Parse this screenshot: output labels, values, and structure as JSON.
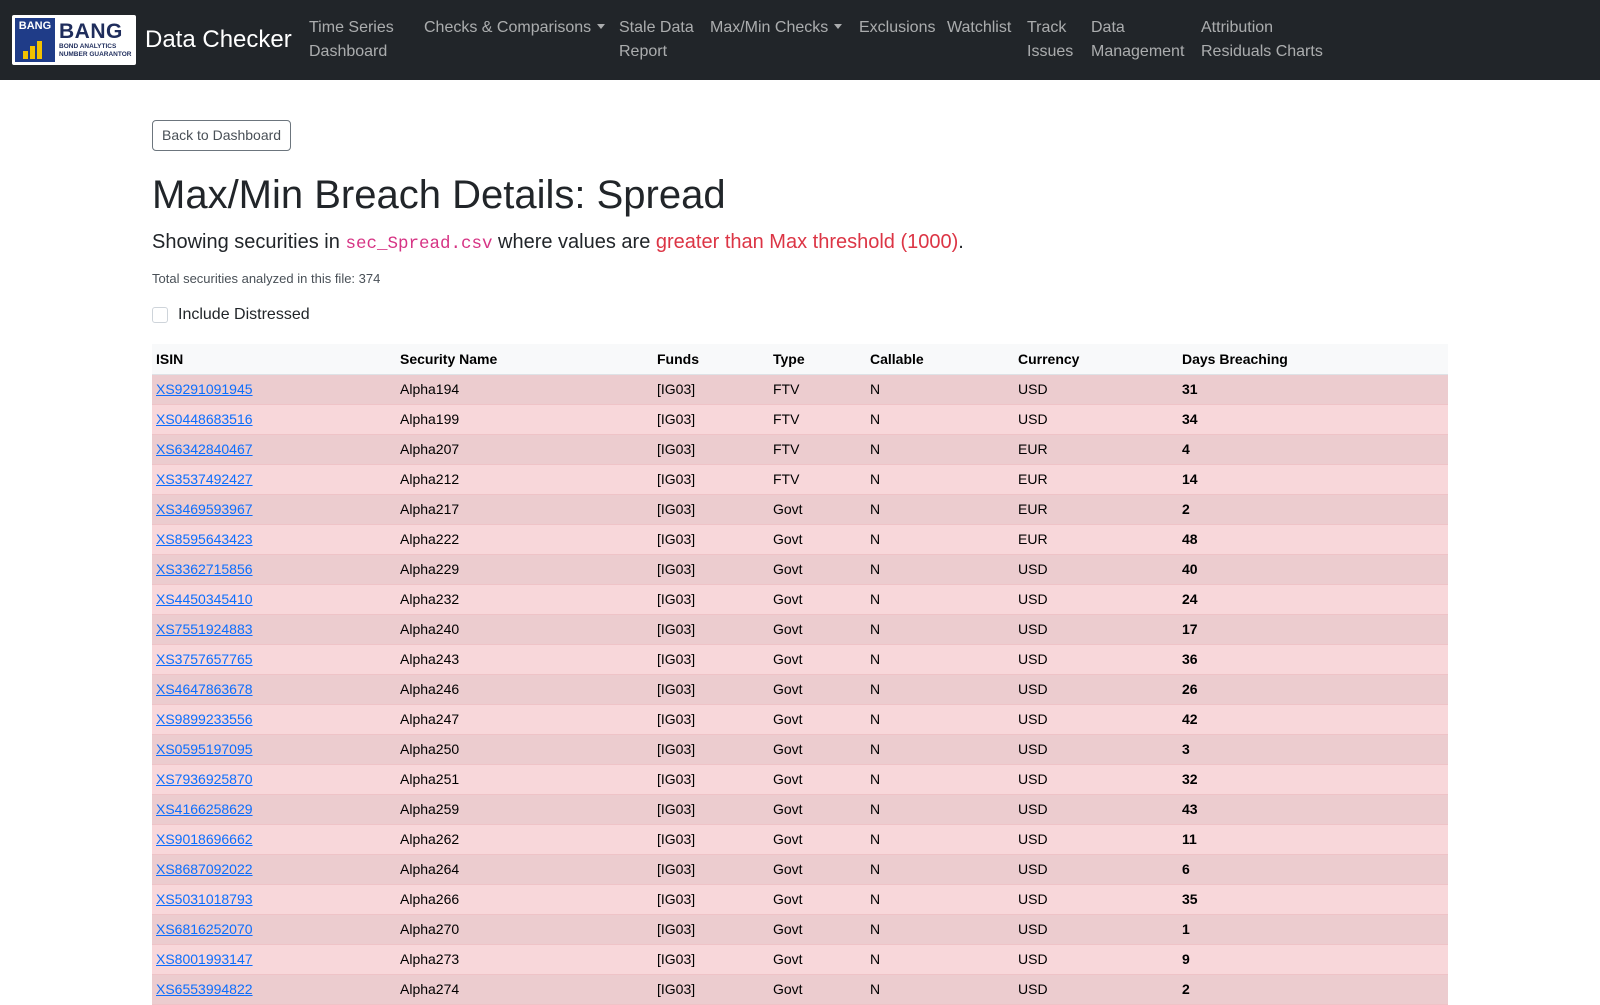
{
  "brand": {
    "logo_short": "BANG",
    "logo_big": "BANG",
    "logo_sub1": "BOND ANALYTICS",
    "logo_sub2": "NUMBER GUARANTOR",
    "title": "Data Checker"
  },
  "nav": [
    {
      "label": "Time Series Dashboard",
      "line1": "Time Series",
      "line2": "Dashboard",
      "dropdown": false
    },
    {
      "label": "Checks & Comparisons",
      "line1": "Checks & Comparisons",
      "line2": "",
      "dropdown": true
    },
    {
      "label": "Stale Data Report",
      "line1": "Stale Data",
      "line2": "Report",
      "dropdown": false
    },
    {
      "label": "Max/Min Checks",
      "line1": "Max/Min Checks",
      "line2": "",
      "dropdown": true
    },
    {
      "label": "Exclusions",
      "line1": "Exclusions",
      "line2": "",
      "dropdown": false
    },
    {
      "label": "Watchlist",
      "line1": "Watchlist",
      "line2": "",
      "dropdown": false
    },
    {
      "label": "Track Issues",
      "line1": "Track",
      "line2": "Issues",
      "dropdown": false
    },
    {
      "label": "Data Management",
      "line1": "Data",
      "line2": "Management",
      "dropdown": false
    },
    {
      "label": "Attribution Residuals Charts",
      "line1": "Attribution",
      "line2": "Residuals Charts",
      "dropdown": false
    }
  ],
  "main": {
    "back_button": "Back to Dashboard",
    "title": "Max/Min Breach Details: Spread",
    "lead_prefix": "Showing securities in ",
    "filename": "sec_Spread.csv",
    "lead_middle": " where values are ",
    "threshold_text": "greater than Max threshold (1000)",
    "lead_suffix": ".",
    "total_text": "Total securities analyzed in this file: 374",
    "checkbox_label": "Include Distressed"
  },
  "table": {
    "headers": [
      "ISIN",
      "Security Name",
      "Funds",
      "Type",
      "Callable",
      "Currency",
      "Days Breaching"
    ],
    "rows": [
      [
        "XS9291091945",
        "Alpha194",
        "[IG03]",
        "FTV",
        "N",
        "USD",
        "31"
      ],
      [
        "XS0448683516",
        "Alpha199",
        "[IG03]",
        "FTV",
        "N",
        "USD",
        "34"
      ],
      [
        "XS6342840467",
        "Alpha207",
        "[IG03]",
        "FTV",
        "N",
        "EUR",
        "4"
      ],
      [
        "XS3537492427",
        "Alpha212",
        "[IG03]",
        "FTV",
        "N",
        "EUR",
        "14"
      ],
      [
        "XS3469593967",
        "Alpha217",
        "[IG03]",
        "Govt",
        "N",
        "EUR",
        "2"
      ],
      [
        "XS8595643423",
        "Alpha222",
        "[IG03]",
        "Govt",
        "N",
        "EUR",
        "48"
      ],
      [
        "XS3362715856",
        "Alpha229",
        "[IG03]",
        "Govt",
        "N",
        "USD",
        "40"
      ],
      [
        "XS4450345410",
        "Alpha232",
        "[IG03]",
        "Govt",
        "N",
        "USD",
        "24"
      ],
      [
        "XS7551924883",
        "Alpha240",
        "[IG03]",
        "Govt",
        "N",
        "USD",
        "17"
      ],
      [
        "XS3757657765",
        "Alpha243",
        "[IG03]",
        "Govt",
        "N",
        "USD",
        "36"
      ],
      [
        "XS4647863678",
        "Alpha246",
        "[IG03]",
        "Govt",
        "N",
        "USD",
        "26"
      ],
      [
        "XS9899233556",
        "Alpha247",
        "[IG03]",
        "Govt",
        "N",
        "USD",
        "42"
      ],
      [
        "XS0595197095",
        "Alpha250",
        "[IG03]",
        "Govt",
        "N",
        "USD",
        "3"
      ],
      [
        "XS7936925870",
        "Alpha251",
        "[IG03]",
        "Govt",
        "N",
        "USD",
        "32"
      ],
      [
        "XS4166258629",
        "Alpha259",
        "[IG03]",
        "Govt",
        "N",
        "USD",
        "43"
      ],
      [
        "XS9018696662",
        "Alpha262",
        "[IG03]",
        "Govt",
        "N",
        "USD",
        "11"
      ],
      [
        "XS8687092022",
        "Alpha264",
        "[IG03]",
        "Govt",
        "N",
        "USD",
        "6"
      ],
      [
        "XS5031018793",
        "Alpha266",
        "[IG03]",
        "Govt",
        "N",
        "USD",
        "35"
      ],
      [
        "XS6816252070",
        "Alpha270",
        "[IG03]",
        "Govt",
        "N",
        "USD",
        "1"
      ],
      [
        "XS8001993147",
        "Alpha273",
        "[IG03]",
        "Govt",
        "N",
        "USD",
        "9"
      ],
      [
        "XS6553994822",
        "Alpha274",
        "[IG03]",
        "Govt",
        "N",
        "USD",
        "2"
      ]
    ]
  }
}
